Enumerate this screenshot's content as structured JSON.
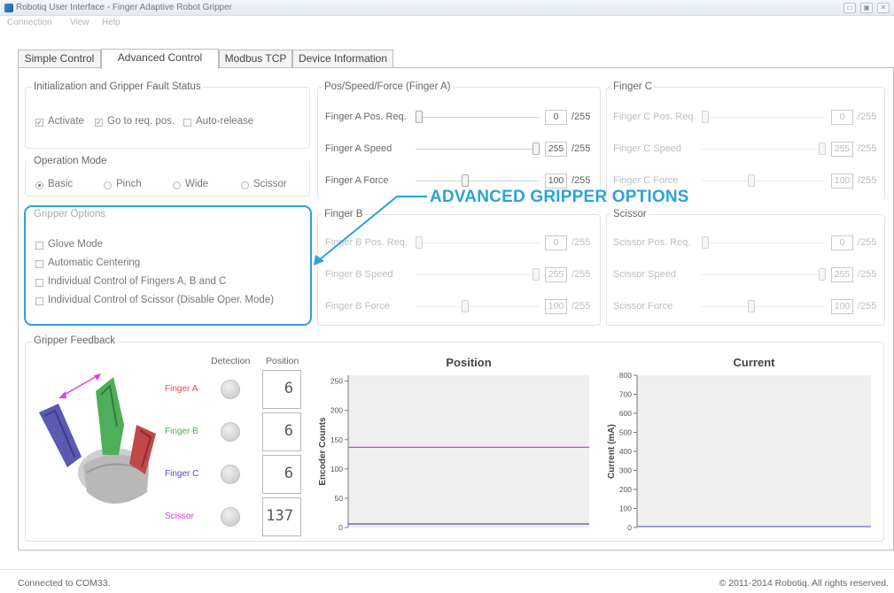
{
  "window": {
    "title": "Robotiq User Interface - Finger Adaptive Robot Gripper",
    "buttons": [
      "▭",
      "▣",
      "✕"
    ]
  },
  "menu": [
    "Connection",
    "View",
    "Help"
  ],
  "tabs": [
    "Simple Control",
    "Advanced Control",
    "Modbus TCP",
    "Device Information"
  ],
  "init": {
    "title": "Initialization and Gripper Fault Status",
    "activate": "Activate",
    "goto": "Go to req. pos.",
    "autorelease": "Auto-release"
  },
  "opmode": {
    "title": "Operation Mode",
    "modes": [
      "Basic",
      "Pinch",
      "Wide",
      "Scissor"
    ]
  },
  "options": {
    "title": "Gripper Options",
    "items": [
      "Glove Mode",
      "Automatic Centering",
      "Individual Control of Fingers A, B and C",
      "Individual Control of Scissor (Disable Oper. Mode)"
    ]
  },
  "fingerA": {
    "title": "Pos/Speed/Force (Finger A)",
    "rows": [
      {
        "label": "Finger A Pos. Req.",
        "value": "0",
        "max": "/255"
      },
      {
        "label": "Finger A Speed",
        "value": "255",
        "max": "/255"
      },
      {
        "label": "Finger A Force",
        "value": "100",
        "max": "/255"
      }
    ]
  },
  "fingerC": {
    "title": "Finger C",
    "rows": [
      {
        "label": "Finger C Pos. Req.",
        "value": "0",
        "max": "/255"
      },
      {
        "label": "Finger C Speed",
        "value": "255",
        "max": "/255"
      },
      {
        "label": "Finger C Force",
        "value": "100",
        "max": "/255"
      }
    ]
  },
  "fingerB": {
    "title": "Finger B",
    "rows": [
      {
        "label": "Finger B Pos. Req.",
        "value": "0",
        "max": "/255"
      },
      {
        "label": "Finger B Speed",
        "value": "255",
        "max": "/255"
      },
      {
        "label": "Finger B Force",
        "value": "100",
        "max": "/255"
      }
    ]
  },
  "scissor": {
    "title": "Scissor",
    "rows": [
      {
        "label": "Scissor Pos. Req.",
        "value": "0",
        "max": "/255"
      },
      {
        "label": "Scissor Speed",
        "value": "255",
        "max": "/255"
      },
      {
        "label": "Scissor Force",
        "value": "100",
        "max": "/255"
      }
    ]
  },
  "callout": "ADVANCED GRIPPER OPTIONS",
  "feedback": {
    "title": "Gripper Feedback",
    "detection": "Detection",
    "position": "Position",
    "rows": [
      {
        "name": "Finger A",
        "color": "#e05050",
        "value": "6"
      },
      {
        "name": "Finger B",
        "color": "#5aa85a",
        "value": "6"
      },
      {
        "name": "Finger C",
        "color": "#5050c0",
        "value": "6"
      },
      {
        "name": "Scissor",
        "color": "#d040d0",
        "value": "137"
      }
    ]
  },
  "colors": {
    "accent": "#2ba3d6",
    "fingerA": "#e05050",
    "fingerB": "#5aa85a",
    "fingerC": "#5050c0",
    "scissor": "#d040d0"
  },
  "chart_data": [
    {
      "type": "line",
      "title": "Position",
      "ylabel": "Encoder Counts",
      "xlabel": "",
      "ylim": [
        0,
        260
      ],
      "yticks": [
        50,
        100,
        150,
        200,
        250
      ],
      "tick_labels": [
        "0",
        "50",
        "100",
        "150",
        "200",
        "250"
      ],
      "series": [
        {
          "color": "#d040d0",
          "values": [
            137,
            137
          ]
        },
        {
          "color": "#5050c0",
          "values": [
            6,
            6
          ]
        }
      ]
    },
    {
      "type": "line",
      "title": "Current",
      "ylabel": "Current (mA)",
      "xlabel": "",
      "ylim": [
        0,
        800
      ],
      "yticks": [
        0,
        100,
        200,
        300,
        400,
        500,
        600,
        700,
        800
      ],
      "tick_labels": [
        "0",
        "100",
        "200",
        "300",
        "400",
        "500",
        "600",
        "700",
        "800"
      ],
      "series": [
        {
          "color": "#6060d0",
          "values": [
            5,
            5
          ]
        }
      ]
    }
  ],
  "status": {
    "left": "Connected to COM33.",
    "right": "© 2011-2014 Robotiq. All rights reserved."
  }
}
